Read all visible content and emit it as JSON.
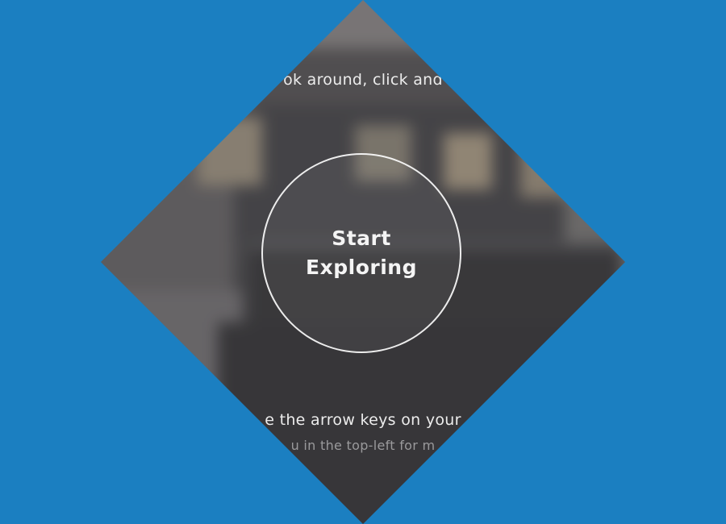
{
  "colors": {
    "background": "#1b7fc1",
    "circle_border": "#ffffff",
    "text_primary": "#ececec",
    "text_secondary": "#9a9a9c"
  },
  "instructions": {
    "top": "ok around, click and",
    "bottom_line1": "e the arrow keys on your",
    "bottom_line2": "u in the top-left for m"
  },
  "start_button": {
    "line1": "Start",
    "line2": "Exploring"
  }
}
